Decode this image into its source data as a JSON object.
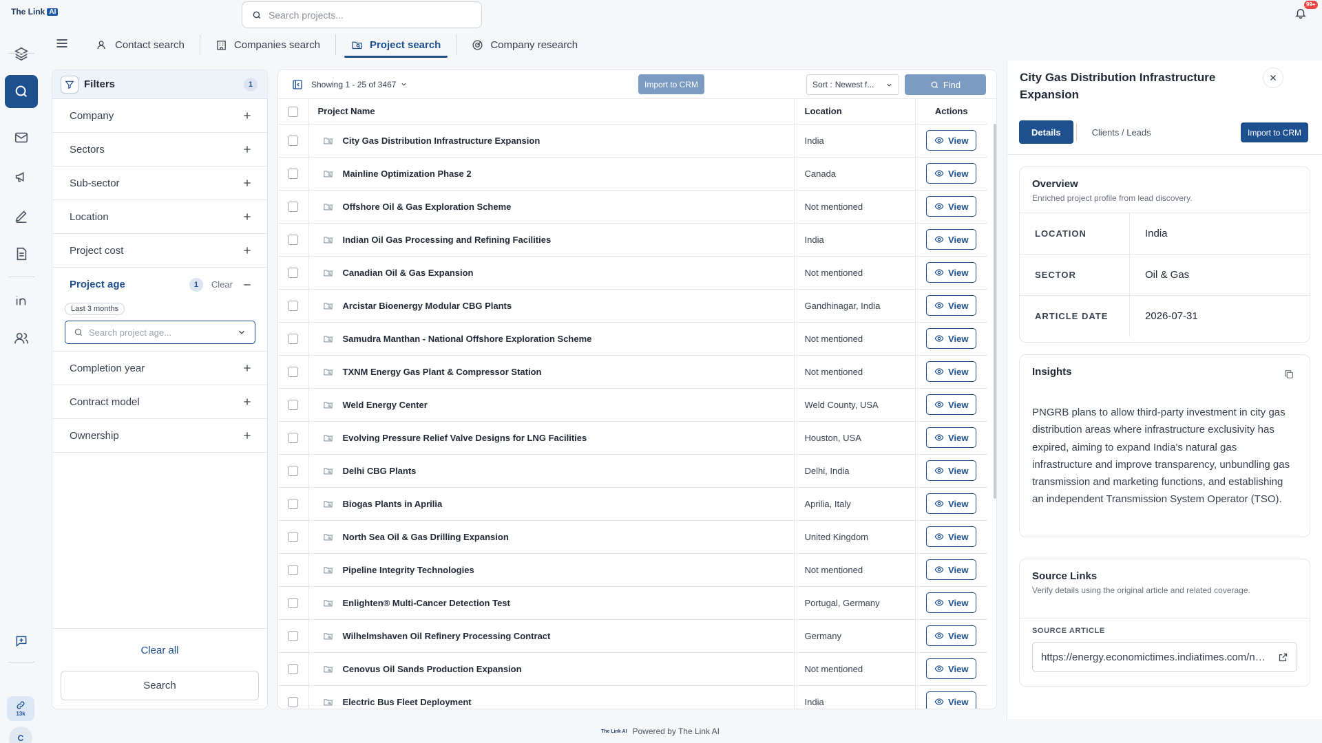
{
  "brand": {
    "name": "The Link",
    "badge": "AI"
  },
  "search": {
    "placeholder": "Search projects..."
  },
  "notifications": {
    "count": "99+"
  },
  "rail": {
    "credits": "13k",
    "avatar_initial": "C"
  },
  "tabs": [
    {
      "label": "Contact search",
      "icon": "contact-icon"
    },
    {
      "label": "Companies search",
      "icon": "building-icon"
    },
    {
      "label": "Project search",
      "icon": "folder-search-icon"
    },
    {
      "label": "Company research",
      "icon": "radar-icon"
    }
  ],
  "filters": {
    "title": "Filters",
    "count": "1",
    "rows": [
      {
        "label": "Company"
      },
      {
        "label": "Sectors"
      },
      {
        "label": "Sub-sector"
      },
      {
        "label": "Location"
      },
      {
        "label": "Project cost"
      }
    ],
    "project_age": {
      "label": "Project age",
      "count": "1",
      "clear": "Clear",
      "chip": "Last 3 months",
      "placeholder": "Search project age..."
    },
    "rows_after": [
      {
        "label": "Completion year"
      },
      {
        "label": "Contract model"
      },
      {
        "label": "Ownership"
      }
    ],
    "clear_all": "Clear all",
    "search": "Search"
  },
  "results": {
    "showing": "Showing 1 - 25 of 3467",
    "import": "Import to CRM",
    "sort_label": "Sort :",
    "sort_value": "Newest f...",
    "find": "Find",
    "columns": {
      "name": "Project Name",
      "location": "Location",
      "actions": "Actions"
    },
    "view_label": "View",
    "rows": [
      {
        "name": "City Gas Distribution Infrastructure Expansion",
        "location": "India"
      },
      {
        "name": "Mainline Optimization Phase 2",
        "location": "Canada"
      },
      {
        "name": "Offshore Oil & Gas Exploration Scheme",
        "location": "Not mentioned"
      },
      {
        "name": "Indian Oil Gas Processing and Refining Facilities",
        "location": "India"
      },
      {
        "name": "Canadian Oil & Gas Expansion",
        "location": "Not mentioned"
      },
      {
        "name": "Arcistar Bioenergy Modular CBG Plants",
        "location": "Gandhinagar, India"
      },
      {
        "name": "Samudra Manthan - National Offshore Exploration Scheme",
        "location": "Not mentioned"
      },
      {
        "name": "TXNM Energy Gas Plant & Compressor Station",
        "location": "Not mentioned"
      },
      {
        "name": "Weld Energy Center",
        "location": "Weld County, USA"
      },
      {
        "name": "Evolving Pressure Relief Valve Designs for LNG Facilities",
        "location": "Houston, USA"
      },
      {
        "name": "Delhi CBG Plants",
        "location": "Delhi, India"
      },
      {
        "name": "Biogas Plants in Aprilia",
        "location": "Aprilia, Italy"
      },
      {
        "name": "North Sea Oil & Gas Drilling Expansion",
        "location": "United Kingdom"
      },
      {
        "name": "Pipeline Integrity Technologies",
        "location": "Not mentioned"
      },
      {
        "name": "Enlighten® Multi-Cancer Detection Test",
        "location": "Portugal, Germany"
      },
      {
        "name": "Wilhelmshaven Oil Refinery Processing Contract",
        "location": "Germany"
      },
      {
        "name": "Cenovus Oil Sands Production Expansion",
        "location": "Not mentioned"
      },
      {
        "name": "Electric Bus Fleet Deployment",
        "location": "India"
      }
    ]
  },
  "detail": {
    "title": "City Gas Distribution Infrastructure Expansion",
    "tabs": {
      "details": "Details",
      "clients": "Clients / Leads"
    },
    "import": "Import to CRM",
    "overview": {
      "title": "Overview",
      "subtitle": "Enriched project profile from lead discovery.",
      "fields": [
        {
          "key": "LOCATION",
          "value": "India"
        },
        {
          "key": "SECTOR",
          "value": "Oil & Gas"
        },
        {
          "key": "ARTICLE DATE",
          "value": "2026-07-31"
        }
      ]
    },
    "insights": {
      "title": "Insights",
      "text": "PNGRB plans to allow third-party investment in city gas distribution areas where infrastructure exclusivity has expired, aiming to expand India's natural gas infrastructure and improve transparency, unbundling gas transmission and marketing functions, and establishing an independent Transmission System Operator (TSO)."
    },
    "sources": {
      "title": "Source Links",
      "subtitle": "Verify details using the original article and related coverage.",
      "label": "SOURCE ARTICLE",
      "url": "https://energy.economictimes.indiatimes.com/news/oil-and-gas"
    }
  },
  "footer": {
    "logo": "The Link AI",
    "text": "Powered by The Link AI"
  }
}
